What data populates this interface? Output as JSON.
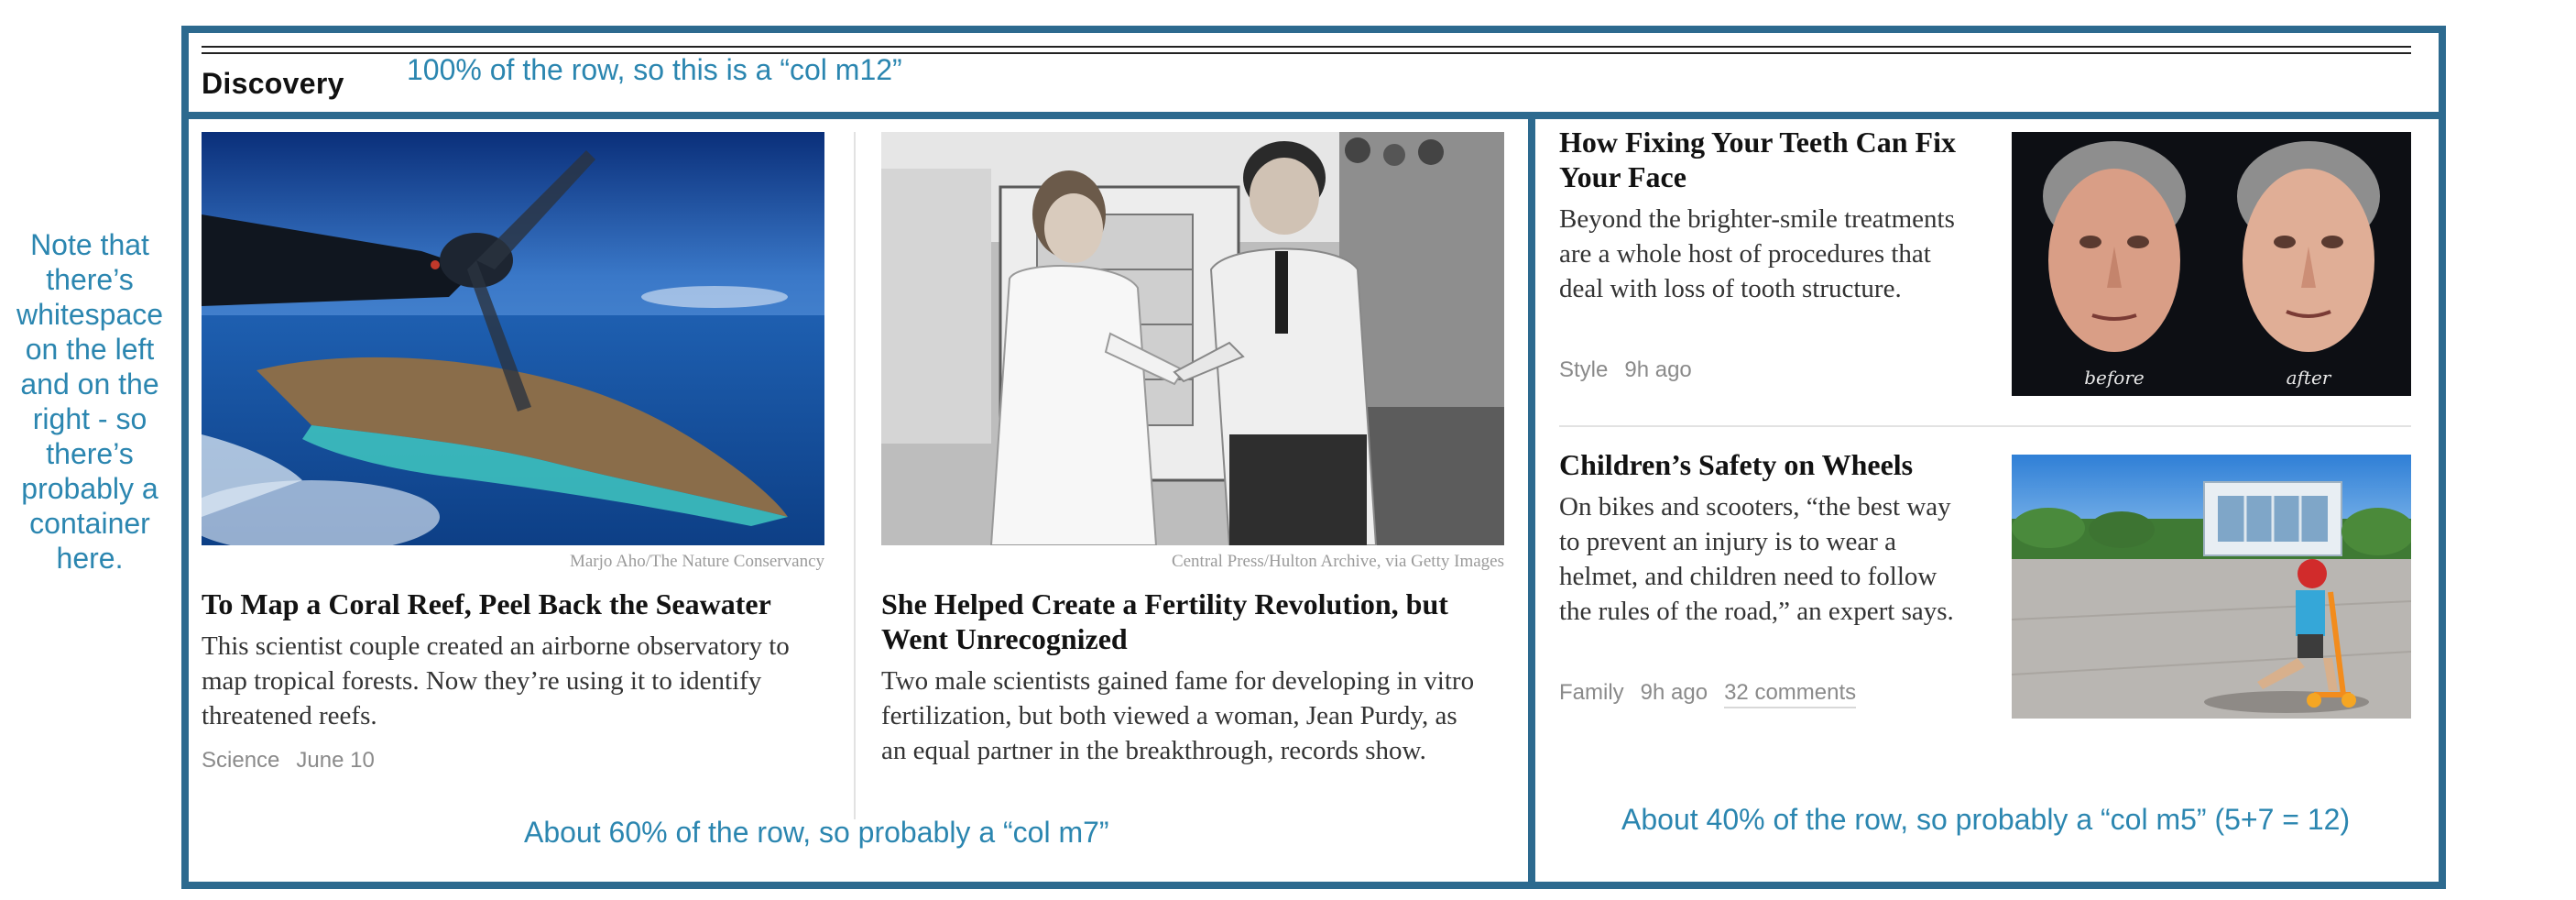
{
  "section": {
    "title": "Discovery"
  },
  "annotations": {
    "left_note": "Note that there’s whitespace on the left and on the right - so there’s probably a container here.",
    "row_note": "100% of the row, so this is a “col m12”",
    "left_col_note": "About 60% of the row, so probably a “col m7”",
    "right_col_note": "About 40% of the row, so probably a “col m5” (5+7 = 12)"
  },
  "articles": [
    {
      "headline": "To Map a Coral Reef, Peel Back the Seawater",
      "summary": "This scientist couple created an airborne observatory to map tropical forests. Now they’re using it to identify threatened reefs.",
      "credit": "Marjo Aho/The Nature Conservancy",
      "section": "Science",
      "time": "June 10"
    },
    {
      "headline": "She Helped Create a Fertility Revolution, but Went Unrecognized",
      "summary": "Two male scientists gained fame for developing in vitro fertilization, but both viewed a woman, Jean Purdy, as an equal partner in the breakthrough, records show.",
      "credit": "Central Press/Hulton Archive, via Getty Images"
    },
    {
      "headline": "How Fixing Your Teeth Can Fix Your Face",
      "summary": "Beyond the brighter-smile treatments are a whole host of procedures that deal with loss of tooth structure.",
      "section": "Style",
      "time": "9h ago",
      "image_labels": {
        "before": "before",
        "after": "after"
      }
    },
    {
      "headline": "Children’s Safety on Wheels",
      "summary": "On bikes and scooters, “the best way to prevent an injury is to wear a helmet, and children need to follow the rules of the road,” an expert says.",
      "section": "Family",
      "time": "9h ago",
      "comments": "32 comments"
    }
  ],
  "colors": {
    "container_border": "#2d6a8f",
    "annotation_text": "#2b86b0"
  }
}
